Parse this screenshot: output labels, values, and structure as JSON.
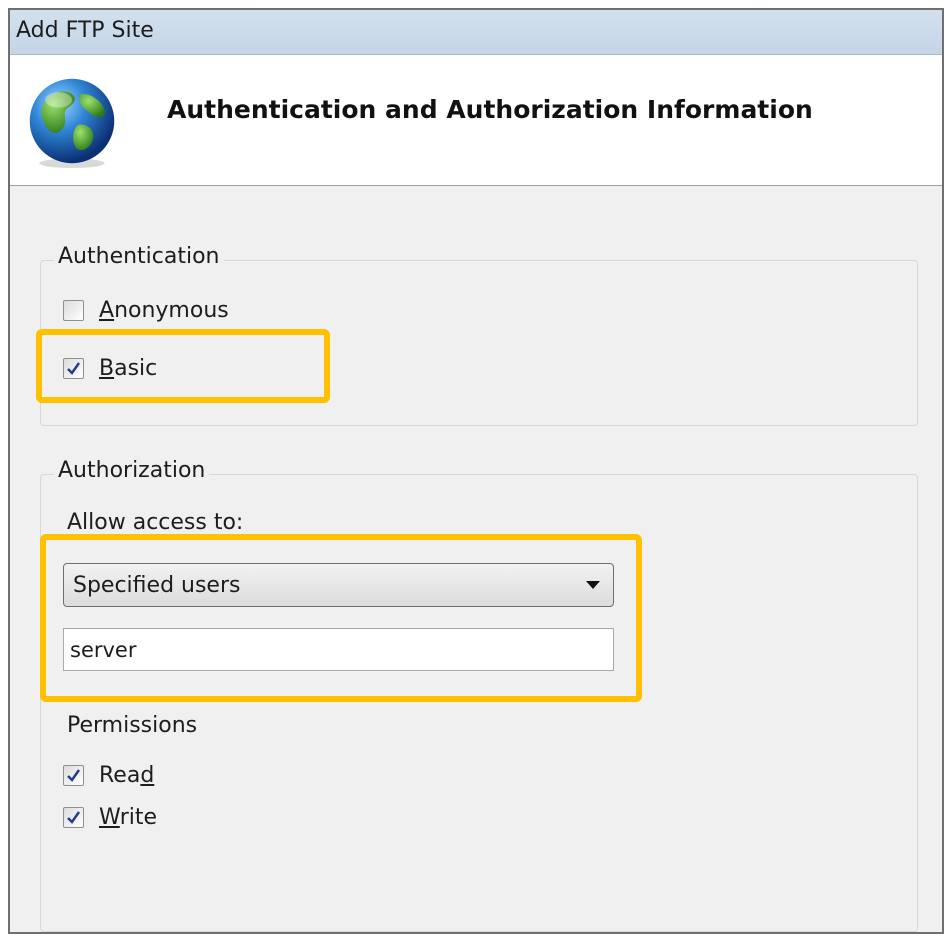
{
  "window": {
    "title": "Add FTP Site"
  },
  "header": {
    "title": "Authentication and Authorization Information",
    "icon": "globe-icon"
  },
  "authentication": {
    "legend": "Authentication",
    "anonymous": {
      "label_pre": "",
      "label_key": "A",
      "label_post": "nonymous",
      "checked": false
    },
    "basic": {
      "label_pre": "",
      "label_key": "B",
      "label_post": "asic",
      "checked": true
    }
  },
  "authorization": {
    "legend": "Authorization",
    "allow_access_label": "Allow access to:",
    "allow_access_value": "Specified users",
    "users_value": "server",
    "permissions_label": "Permissions",
    "read": {
      "label_pre": "Rea",
      "label_key": "d",
      "label_post": "",
      "checked": true
    },
    "write": {
      "label_pre": "",
      "label_key": "W",
      "label_post": "rite",
      "checked": true
    }
  },
  "colors": {
    "highlight": "#ffc000",
    "title_bar": "#c8d8e8"
  }
}
